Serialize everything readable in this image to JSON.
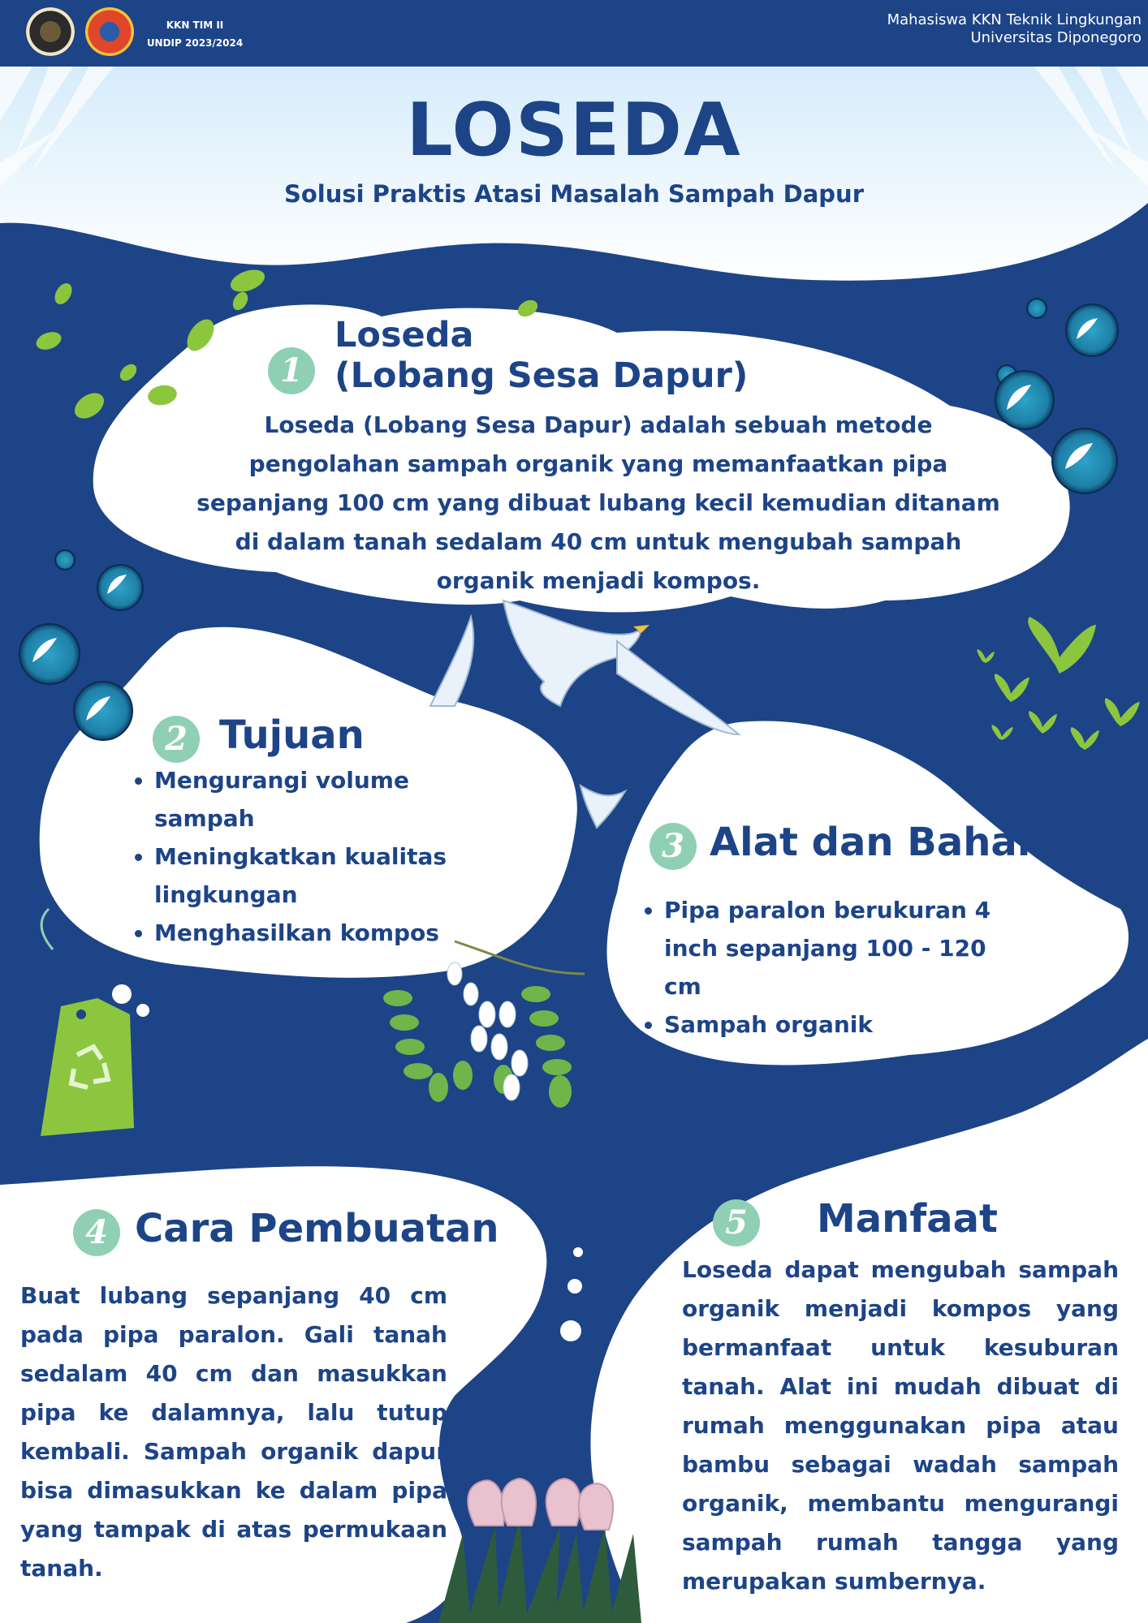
{
  "header": {
    "kkn_team": "KKN TIM II",
    "kkn_period": "UNDIP 2023/2024",
    "org_line1": "Mahasiswa KKN Teknik Lingkungan",
    "org_line2": "Universitas Diponegoro"
  },
  "title": "LOSEDA",
  "subtitle": "Solusi Praktis Atasi Masalah Sampah Dapur",
  "sections": [
    {
      "number": "1",
      "heading_line1": "Loseda",
      "heading_line2": "(Lobang Sesa Dapur)",
      "body": "Loseda (Lobang Sesa Dapur) adalah sebuah metode pengolahan sampah organik yang memanfaatkan pipa sepanjang 100 cm yang dibuat lubang kecil kemudian ditanam di dalam tanah sedalam 40 cm untuk mengubah sampah organik menjadi kompos."
    },
    {
      "number": "2",
      "heading": "Tujuan",
      "items": [
        "Mengurangi volume sampah",
        "Meningkatkan kualitas lingkungan",
        "Menghasilkan kompos"
      ]
    },
    {
      "number": "3",
      "heading": "Alat dan Bahan",
      "items": [
        "Pipa paralon berukuran 4 inch sepanjang 100 - 120 cm",
        "Sampah organik"
      ]
    },
    {
      "number": "4",
      "heading": "Cara Pembuatan",
      "body": "Buat lubang sepanjang 40 cm pada pipa paralon. Gali tanah sedalam 40 cm dan masukkan pipa ke dalamnya, lalu tutup kembali. Sampah organik dapur bisa dimasukkan ke dalam pipa yang tampak di atas permukaan tanah."
    },
    {
      "number": "5",
      "heading": "Manfaat",
      "body": "Loseda dapat mengubah sampah organik menjadi kompos yang bermanfaat untuk kesuburan tanah. Alat ini mudah dibuat di rumah menggunakan pipa atau bambu sebagai wadah sampah organik, membantu mengurangi sampah rumah tangga yang merupakan sumbernya."
    }
  ],
  "colors": {
    "navy": "#1d4487",
    "mint": "#8fd0b4",
    "leaf": "#8cc63f",
    "white": "#ffffff"
  },
  "icons": [
    "university-logo",
    "kkn-logo",
    "leaf-icon",
    "bubble-icon",
    "bird-icon",
    "butterfly-icon",
    "recycle-tag-icon",
    "tulip-icon",
    "branch-icon"
  ]
}
